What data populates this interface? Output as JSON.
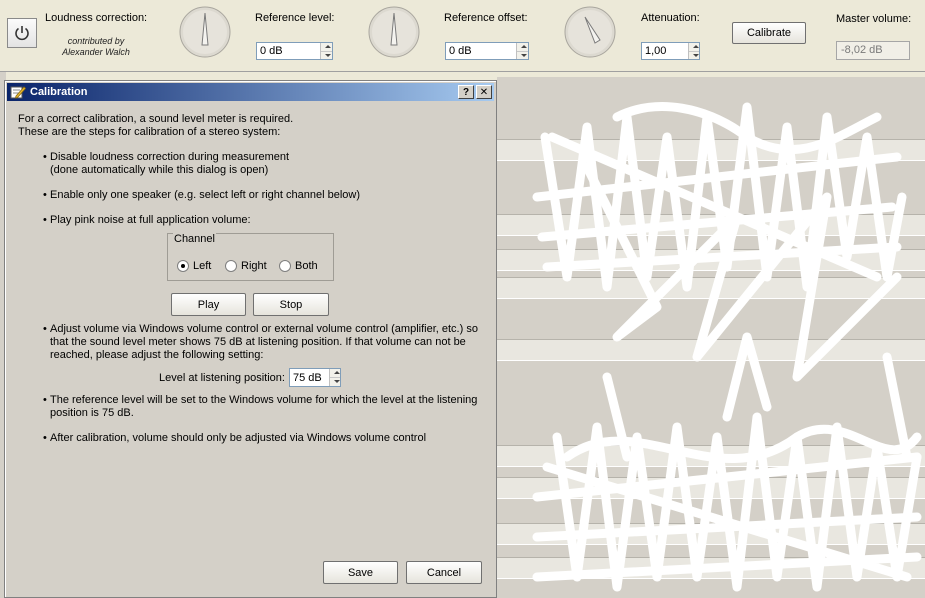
{
  "toolbar": {
    "loudness_label": "Loudness correction:",
    "contributed_line1": "contributed by",
    "contributed_line2": "Alexander Walch",
    "reference_level_label": "Reference level:",
    "reference_level_value": "0 dB",
    "reference_offset_label": "Reference offset:",
    "reference_offset_value": "0 dB",
    "attenuation_label": "Attenuation:",
    "attenuation_value": "1,00",
    "calibrate_label": "Calibrate",
    "master_volume_label": "Master volume:",
    "master_volume_value": "-8,02 dB"
  },
  "dialog": {
    "title": "Calibration",
    "help_glyph": "?",
    "close_glyph": "✕",
    "intro_line1": "For a correct calibration, a sound level meter is required.",
    "intro_line2": "These are the steps for calibration of a stereo system:",
    "step1_line1": "Disable loudness correction during measurement",
    "step1_line2": "(done automatically while this dialog is open)",
    "step2": "Enable only one speaker (e.g. select left or right channel below)",
    "step3": "Play pink noise at full application volume:",
    "channel_legend": "Channel",
    "channel_options": [
      "Left",
      "Right",
      "Both"
    ],
    "channel_selected": "Left",
    "play_label": "Play",
    "stop_label": "Stop",
    "step4_line1": "Adjust volume via Windows volume control or external volume control (amplifier, etc.) so",
    "step4_line2": "that the sound level meter shows 75 dB at listening position. If that volume can not be",
    "step4_line3": "reached, please adjust the following setting:",
    "listening_label": "Level at listening position:",
    "listening_value": "75 dB",
    "step5_line1": "The reference level will be set to the Windows volume for which the level at the listening",
    "step5_line2": "position is 75 dB.",
    "step6": "After calibration, volume should only be adjusted via Windows volume control",
    "save_label": "Save",
    "cancel_label": "Cancel"
  },
  "colors": {
    "titlebar_start": "#0a246a",
    "titlebar_end": "#a6caf0",
    "dialog_bg": "#d4d0c8"
  }
}
